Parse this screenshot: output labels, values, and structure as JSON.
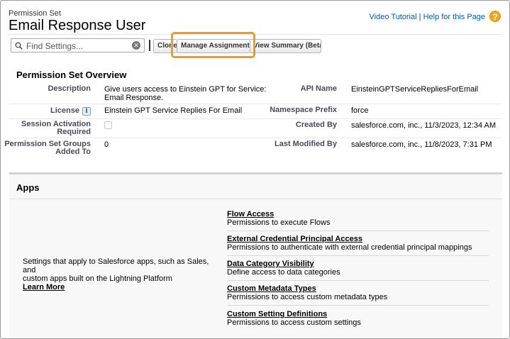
{
  "header": {
    "eyebrow": "Permission Set",
    "title": "Email Response User",
    "video_tutorial": "Video Tutorial",
    "separator": " | ",
    "help_link": "Help for this Page",
    "help_icon": "?"
  },
  "toolbar": {
    "search_placeholder": "Find Settings...",
    "clone_label": "Clone",
    "manage_label": "Manage Assignments",
    "view_summary_label": "View Summary (Beta)"
  },
  "overview": {
    "title": "Permission Set Overview",
    "description_label": "Description",
    "description_line1": "Give users access to Einstein GPT for Service:",
    "description_line2": "Email Response.",
    "api_name_label": "API Name",
    "api_name_value": "EinsteinGPTServiceRepliesForEmail",
    "license_label": "License",
    "license_value": "Einstein GPT Service Replies For Email",
    "info_icon": "i",
    "namespace_label": "Namespace Prefix",
    "namespace_value": "force",
    "session_label_line1": "Session Activation",
    "session_label_line2": "Required",
    "created_by_label": "Created By",
    "created_by_value": "salesforce.com, inc., 11/3/2023, 12:34 AM",
    "groups_label_line1": "Permission Set Groups",
    "groups_label_line2": "Added To",
    "groups_value": "0",
    "modified_label": "Last Modified By",
    "modified_value": "salesforce.com, inc., 11/8/2023, 7:31 PM"
  },
  "apps": {
    "title": "Apps",
    "description_line1": "Settings that apply to Salesforce apps, such as Sales, and",
    "description_line2": "custom apps built on the Lightning Platform",
    "learn_more": "Learn More",
    "permissions": [
      {
        "name": "Flow Access",
        "description": "Permissions to execute Flows"
      },
      {
        "name": "External Credential Principal Access",
        "description": "Permissions to authenticate with external credential principal mappings"
      },
      {
        "name": "Data Category Visibility",
        "description": "Define access to data categories"
      },
      {
        "name": "Custom Metadata Types",
        "description": "Permissions to access custom metadata types"
      },
      {
        "name": "Custom Setting Definitions",
        "description": "Permissions to access custom settings"
      }
    ]
  }
}
